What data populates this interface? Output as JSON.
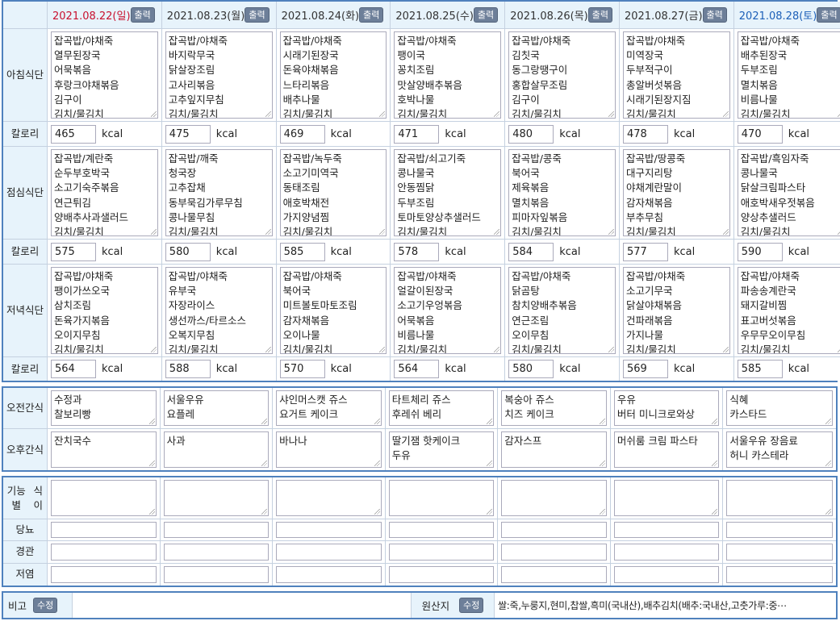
{
  "header": {
    "print_label": "출력",
    "dates": [
      "2021.08.22(일)",
      "2021.08.23(월)",
      "2021.08.24(화)",
      "2021.08.25(수)",
      "2021.08.26(목)",
      "2021.08.27(금)",
      "2021.08.28(토)"
    ]
  },
  "labels": {
    "breakfast": [
      "아침",
      "식단"
    ],
    "lunch": [
      "점심",
      "식단"
    ],
    "dinner": [
      "저녁",
      "식단"
    ],
    "calorie": "칼로리",
    "am_snack": [
      "오전",
      "간식"
    ],
    "pm_snack": [
      "오후",
      "간식"
    ],
    "functional": [
      "기능별",
      "식이"
    ],
    "diabetes": "당뇨",
    "tube": "경관",
    "low_salt": "저염",
    "kcal": "kcal"
  },
  "breakfast": [
    [
      "잡곡밥/야채죽",
      "열무된장국",
      "어묵볶음",
      "후랑크야채볶음",
      "김구이",
      "김치/물김치"
    ],
    [
      "잡곡밥/야채죽",
      "바지락무국",
      "닭살장조림",
      "고사리볶음",
      "고추잎지무침",
      "김치/물김치"
    ],
    [
      "잡곡밥/야채죽",
      "시래기된장국",
      "돈육야채볶음",
      "느타리볶음",
      "배추나물",
      "김치/물김치"
    ],
    [
      "잡곡밥/야채죽",
      "팽이국",
      "꽁치조림",
      "맛살양배추볶음",
      "호박나물",
      "김치/물김치"
    ],
    [
      "잡곡밥/야채죽",
      "김칫국",
      "동그랑땡구이",
      "홍합살무조림",
      "김구이",
      "김치/물김치"
    ],
    [
      "잡곡밥/야채죽",
      "미역장국",
      "두부적구이",
      "총알버섯볶음",
      "시래기된장지짐",
      "김치/물김치"
    ],
    [
      "잡곡밥/야채죽",
      "배추된장국",
      "두부조림",
      "멸치볶음",
      "비름나물",
      "김치/물김치"
    ]
  ],
  "breakfast_kcal": [
    "465",
    "475",
    "469",
    "471",
    "480",
    "478",
    "470"
  ],
  "lunch": [
    [
      "잡곡밥/계란죽",
      "순두부호박국",
      "소고기숙주볶음",
      "연근튀김",
      "양배추사과샐러드",
      "김치/물김치"
    ],
    [
      "잡곡밥/깨죽",
      "청국장",
      "고추잡채",
      "동부묵김가루무침",
      "콩나물무침",
      "김치/물김치"
    ],
    [
      "잡곡밥/녹두죽",
      "소고기미역국",
      "동태조림",
      "애호박채전",
      "가지양념찜",
      "김치/물김치"
    ],
    [
      "잡곡밥/쇠고기죽",
      "콩나물국",
      "안동찜닭",
      "두부조림",
      "토마토양상추샐러드",
      "김치/물김치"
    ],
    [
      "잡곡밥/콩죽",
      "북어국",
      "제육볶음",
      "멸치볶음",
      "피마자잎볶음",
      "김치/물김치"
    ],
    [
      "잡곡밥/땅콩죽",
      "대구지리탕",
      "야채계란말이",
      "감자채볶음",
      "부추무침",
      "김치/물김치"
    ],
    [
      "잡곡밥/흑임자죽",
      "콩나물국",
      "닭살크림파스타",
      "애호박새우젓볶음",
      "양상추샐러드",
      "김치/물김치"
    ]
  ],
  "lunch_kcal": [
    "575",
    "580",
    "585",
    "578",
    "584",
    "577",
    "590"
  ],
  "dinner": [
    [
      "잡곡밥/야채죽",
      "팽이가쓰오국",
      "삼치조림",
      "돈육가지볶음",
      "오이지무침",
      "김치/물김치"
    ],
    [
      "잡곡밥/야채죽",
      "유부국",
      "자장라이스",
      "생선까스/타르소스",
      "오복지무침",
      "김치/물김치"
    ],
    [
      "잡곡밥/야채죽",
      "북어국",
      "미트볼토마토조림",
      "감자채볶음",
      "오이나물",
      "김치/물김치"
    ],
    [
      "잡곡밥/야채죽",
      "얼갈이된장국",
      "소고기우엉볶음",
      "어묵볶음",
      "비름나물",
      "김치/물김치"
    ],
    [
      "잡곡밥/야채죽",
      "닭곰탕",
      "참치양배추볶음",
      "연근조림",
      "오이무침",
      "김치/물김치"
    ],
    [
      "잡곡밥/야채죽",
      "소고기무국",
      "닭살야채볶음",
      "건파래볶음",
      "가지나물",
      "김치/물김치"
    ],
    [
      "잡곡밥/야채죽",
      "파송송계란국",
      "돼지갈비찜",
      "표고버섯볶음",
      "우무무오이무침",
      "김치/물김치"
    ]
  ],
  "dinner_kcal": [
    "564",
    "588",
    "570",
    "564",
    "580",
    "569",
    "585"
  ],
  "am_snack": [
    [
      "수정과",
      "찰보리빵"
    ],
    [
      "서울우유",
      "요플레"
    ],
    [
      "샤인머스캣 쥬스",
      "요거트 케이크"
    ],
    [
      "타트체리 쥬스",
      "후레쉬 베리"
    ],
    [
      "복숭아 쥬스",
      "치즈 케이크"
    ],
    [
      "우유",
      "버터 미니크로와상"
    ],
    [
      "식혜",
      "카스타드"
    ]
  ],
  "pm_snack": [
    [
      "잔치국수"
    ],
    [
      "사과"
    ],
    [
      "바나나"
    ],
    [
      "딸기잼 핫케이크",
      "두유"
    ],
    [
      "감자스프"
    ],
    [
      "머쉬룸 크림 파스타"
    ],
    [
      "서울우유 장음료",
      "허니 카스테라"
    ]
  ],
  "footer": {
    "remark_label": "비고",
    "edit_label": "수정",
    "origin_label": "원산지",
    "origin_text": "쌀:죽,누룽지,현미,찹쌀,흑미(국내산),배추김치(배추:국내산,고춧가루:중⋯"
  }
}
